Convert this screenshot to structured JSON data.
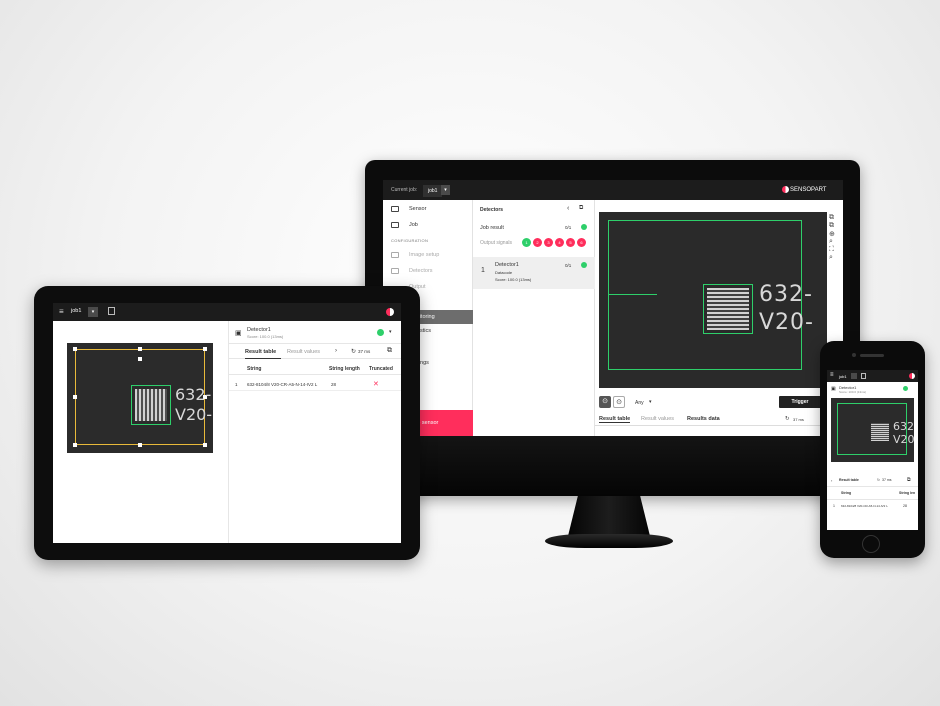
{
  "monitor": {
    "topbar": {
      "current_job_label": "Current job:",
      "job_value": "job1",
      "brand": "SENSOPART"
    },
    "nav": {
      "items": [
        {
          "label": "Sensor"
        },
        {
          "label": "Job"
        }
      ],
      "section_configuration": "CONFIGURATION",
      "config_items": [
        {
          "label": "Image setup"
        },
        {
          "label": "Detectors"
        },
        {
          "label": "Output"
        }
      ],
      "selected_item": "Monitoring",
      "statistics": "Statistics",
      "settings": "Settings",
      "stop_button": "Stop sensor"
    },
    "detectors": {
      "title": "Detectors",
      "job_result_label": "Job result",
      "job_result_value": "0/1",
      "output_signals_label": "Output signals",
      "signals": [
        "1",
        "2",
        "3",
        "4",
        "5",
        "6"
      ],
      "detector": {
        "index": "1",
        "name": "Detector1",
        "type": "Datacode",
        "score": "Score: 100.0 (13ms)",
        "value": "0/1"
      }
    },
    "viewer": {
      "etched_line1": "632-",
      "etched_line2": "V20-",
      "any_label": "Any",
      "trigger_button": "Trigger",
      "tabs": [
        "Result table",
        "Result values",
        "Results data"
      ],
      "timing": "37 ms"
    }
  },
  "tablet": {
    "job_value": "job1",
    "etched_line1": "632-",
    "etched_line2": "V20-",
    "detector": {
      "name": "Detector1",
      "score": "Score: 100.0 (13ms)"
    },
    "tabs": [
      "Result table",
      "Result values"
    ],
    "timing": "37 ms",
    "table": {
      "headers": [
        "String",
        "String length",
        "Truncated"
      ],
      "rows": [
        {
          "index": "1",
          "string": "632-8104/8 V20-CR-A5-N-14-IV2 L",
          "length": "28",
          "truncated": "✕"
        }
      ]
    }
  },
  "phone": {
    "job_value": "job1",
    "detector": {
      "name": "Detector1",
      "score": "Score: 100.0 (13ms)"
    },
    "etched_line1": "632-",
    "etched_line2": "V20-",
    "tabs": [
      "Result table"
    ],
    "timing": "37 ms",
    "table": {
      "headers": [
        "String",
        "String len"
      ],
      "rows": [
        {
          "index": "1",
          "string": "632-8104/8 V20-CR-A5-N-14-IV2 L",
          "length": "28"
        }
      ]
    }
  },
  "colors": {
    "accent": "#ff2e5c",
    "ok": "#2ecf6a",
    "roi_tablet": "#e8b93a"
  }
}
